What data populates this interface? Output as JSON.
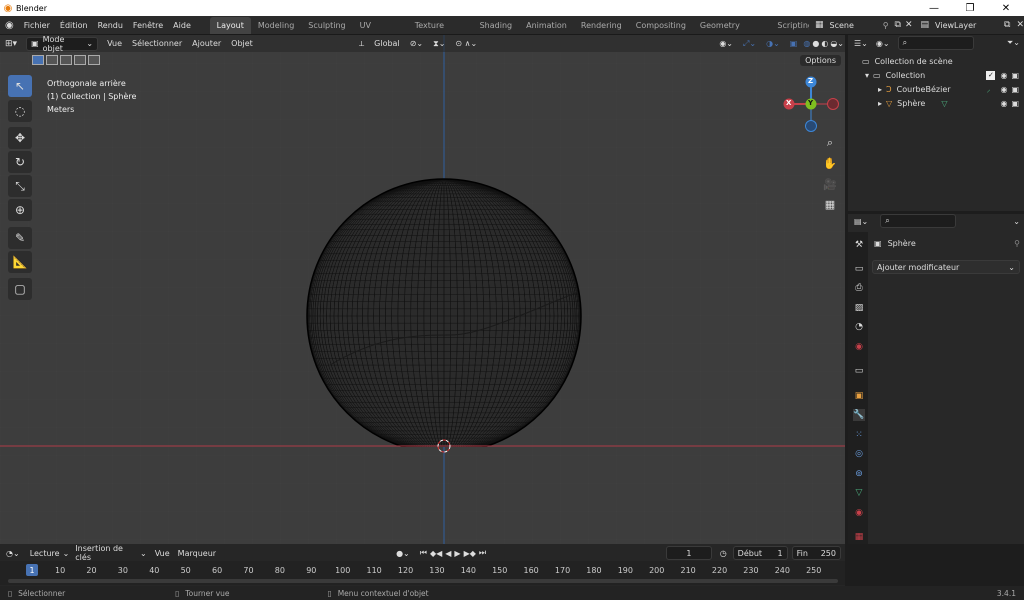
{
  "window": {
    "title": "Blender",
    "min": "—",
    "max": "❐",
    "close": "✕"
  },
  "menu": [
    "Fichier",
    "Édition",
    "Rendu",
    "Fenêtre",
    "Aide"
  ],
  "workspaces": [
    "Layout",
    "Modeling",
    "Sculpting",
    "UV Editing",
    "Texture Paint",
    "Shading",
    "Animation",
    "Rendering",
    "Compositing",
    "Geometry Nodes",
    "Scripting"
  ],
  "scene": "Scene",
  "view_layer": "ViewLayer",
  "viewport": {
    "mode": "Mode objet",
    "menus": [
      "Vue",
      "Sélectionner",
      "Ajouter",
      "Objet"
    ],
    "orientation": "Global",
    "options": "Options",
    "overlay_lines": [
      "Orthogonale arrière",
      "(1) Collection | Sphère",
      "Meters"
    ],
    "gizmo": {
      "z": "Z",
      "x": "X",
      "y": "Y"
    }
  },
  "outliner": {
    "root": "Collection de scène",
    "collection": "Collection",
    "items": [
      "CourbeBézier",
      "Sphère"
    ]
  },
  "properties": {
    "object": "Sphère",
    "add_modifier": "Ajouter modificateur"
  },
  "timeline": {
    "menus": [
      "Lecture",
      "Insertion de clés",
      "Vue",
      "Marqueur"
    ],
    "current": "1",
    "start_label": "Début",
    "start": "1",
    "end_label": "Fin",
    "end": "250",
    "ticks": [
      "1",
      "10",
      "20",
      "30",
      "40",
      "50",
      "60",
      "70",
      "80",
      "90",
      "100",
      "110",
      "120",
      "130",
      "140",
      "150",
      "160",
      "170",
      "180",
      "190",
      "200",
      "210",
      "220",
      "230",
      "240",
      "250"
    ]
  },
  "status": {
    "select": "Sélectionner",
    "rotate": "Tourner vue",
    "context": "Menu contextuel d'objet",
    "version": "3.4.1"
  },
  "colors": {
    "accent": "#4772b3",
    "x_axis": "#c8404a",
    "y_axis": "#7fbf1f",
    "z_axis": "#3d87d8",
    "bg_viewport": "#3d3d3d"
  }
}
